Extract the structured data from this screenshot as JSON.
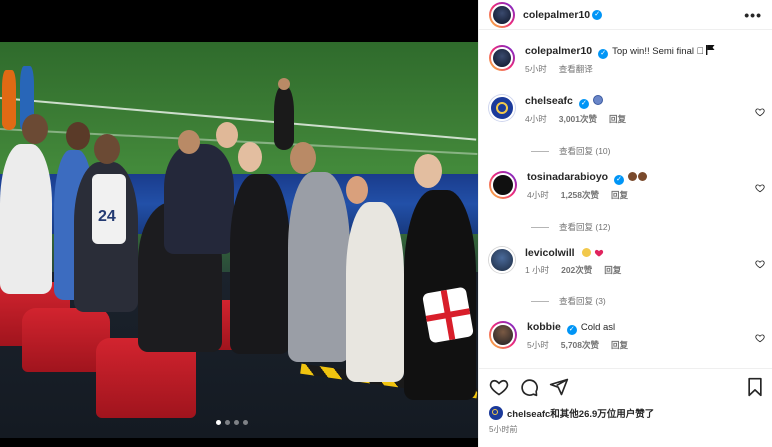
{
  "post": {
    "author": "colepalmer10",
    "caption_author": "colepalmer10",
    "caption_text": "Top win!! Semi final 🏻",
    "caption_time": "5小时",
    "caption_translate": "查看翻译",
    "more_label": "•••"
  },
  "comments": [
    {
      "user": "chelseafc",
      "text": "",
      "time": "4小时",
      "likes": "3,001次赞",
      "reply_label": "回复",
      "view_replies": "查看回复 (10)"
    },
    {
      "user": "tosinadarabioyo",
      "text": "",
      "time": "4小时",
      "likes": "1,258次赞",
      "reply_label": "回复",
      "view_replies": "查看回复 (12)"
    },
    {
      "user": "levicolwill",
      "text": "",
      "time": "1 小时",
      "likes": "202次赞",
      "reply_label": "回复",
      "view_replies": "查看回复 (3)"
    },
    {
      "user": "kobbie",
      "text": "Cold asl",
      "time": "5小时",
      "likes": "5,708次赞",
      "reply_label": "回复",
      "view_replies": ""
    }
  ],
  "footer": {
    "likes_text": "chelseafc和其他26.9万位用户赞了",
    "time": "5小时前"
  },
  "photo": {
    "jersey_number": "24"
  },
  "colors": {
    "verified": "#0095f6",
    "muted": "#737373",
    "seat_red": "#c51d27",
    "pitch_green": "#3c7d35"
  },
  "icons": [
    "more-options-icon",
    "heart-icon",
    "comment-icon",
    "share-icon",
    "bookmark-icon",
    "verified-icon",
    "flag-icon"
  ]
}
